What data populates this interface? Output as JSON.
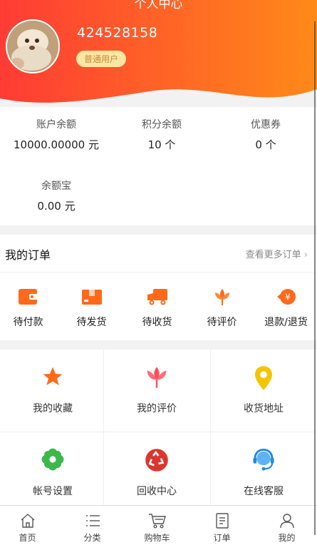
{
  "header": {
    "title": "个人中心",
    "username": "424528158",
    "badge": "普通用户"
  },
  "stats": [
    {
      "label": "账户余额",
      "value": "10000.00000 元"
    },
    {
      "label": "积分余额",
      "value": "10 个"
    },
    {
      "label": "优惠券",
      "value": "0 个"
    },
    {
      "label": "余额宝",
      "value": "0.00 元"
    }
  ],
  "orders": {
    "title": "我的订单",
    "more": "查看更多订单",
    "items": [
      {
        "label": "待付款",
        "icon": "wallet-icon"
      },
      {
        "label": "待发货",
        "icon": "box-icon"
      },
      {
        "label": "待收货",
        "icon": "truck-icon"
      },
      {
        "label": "待评价",
        "icon": "flower-icon"
      },
      {
        "label": "退款/退货",
        "icon": "refund-icon"
      }
    ]
  },
  "services": [
    {
      "label": "我的收藏",
      "icon": "star-icon"
    },
    {
      "label": "我的评价",
      "icon": "tulip-icon"
    },
    {
      "label": "收货地址",
      "icon": "location-pin-icon"
    },
    {
      "label": "帐号设置",
      "icon": "settings-flower-icon"
    },
    {
      "label": "回收中心",
      "icon": "recycle-icon"
    },
    {
      "label": "在线客服",
      "icon": "customer-service-icon"
    }
  ],
  "tabbar": [
    {
      "label": "首页",
      "icon": "home-icon"
    },
    {
      "label": "分类",
      "icon": "list-icon"
    },
    {
      "label": "购物车",
      "icon": "cart-icon"
    },
    {
      "label": "订单",
      "icon": "order-icon"
    },
    {
      "label": "我的",
      "icon": "user-icon"
    }
  ],
  "colors": {
    "accent": "#ff6a1a",
    "accent_red": "#ff3b35",
    "badge_bg": "#fbe7a1",
    "badge_text": "#c8893a",
    "pin_yellow": "#f5c400",
    "leaf_green": "#3cb84a",
    "recycle_red": "#d9372e",
    "service_blue": "#1e8be0"
  }
}
